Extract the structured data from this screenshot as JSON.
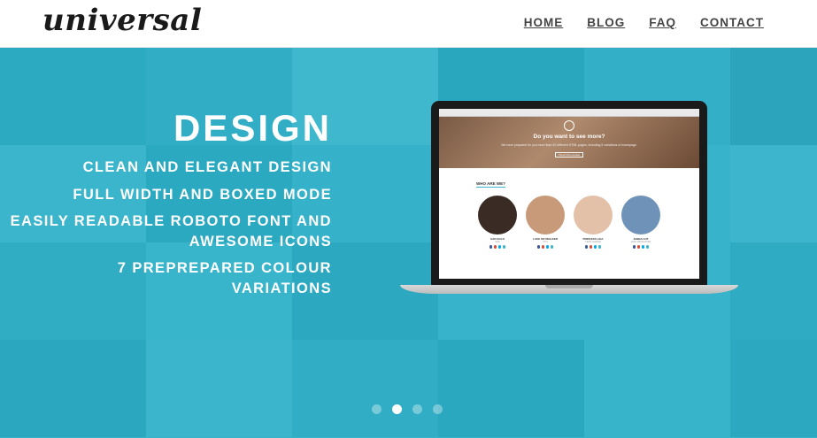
{
  "header": {
    "logo": "universal",
    "nav": [
      {
        "label": "HOME"
      },
      {
        "label": "BLOG"
      },
      {
        "label": "FAQ"
      },
      {
        "label": "CONTACT"
      }
    ]
  },
  "hero": {
    "title": "DESIGN",
    "features": [
      {
        "line1": "CLEAN AND ELEGANT DESIGN",
        "line2": ""
      },
      {
        "line1": "FULL WIDTH AND BOXED MODE",
        "line2": ""
      },
      {
        "line1": "EASILY READABLE ROBOTO FONT AND",
        "line2": "AWESOME ICONS"
      },
      {
        "line1": "7 PREPREPARED COLOUR",
        "line2": "VARIATIONS"
      }
    ],
    "accent_color": "#3fb6cc"
  },
  "laptop_preview": {
    "hero_title": "Do you want to see more?",
    "hero_sub": "We have prepared for you more than 40 different HTML pages, including 5 variations of homepage.",
    "hero_button": "Check this template",
    "section_title": "WHO ARE WE?",
    "people": [
      {
        "name": "HAN SOLO",
        "role": "CEO",
        "avatar_color": "#3a2c25"
      },
      {
        "name": "LUKE SKYWALKER",
        "role": "CTO",
        "avatar_color": "#c99a7a"
      },
      {
        "name": "PRINCESS LEIA",
        "role": "TEAM LEADER",
        "avatar_color": "#e2c1a8"
      },
      {
        "name": "JABBA HUT",
        "role": "LEAD DEVELOPER",
        "avatar_color": "#6f93b8"
      }
    ],
    "social_colors": [
      "#3b5998",
      "#dd4b39",
      "#00aced",
      "#3fb6cc"
    ]
  },
  "carousel": {
    "slides": 4,
    "active_index": 1
  }
}
